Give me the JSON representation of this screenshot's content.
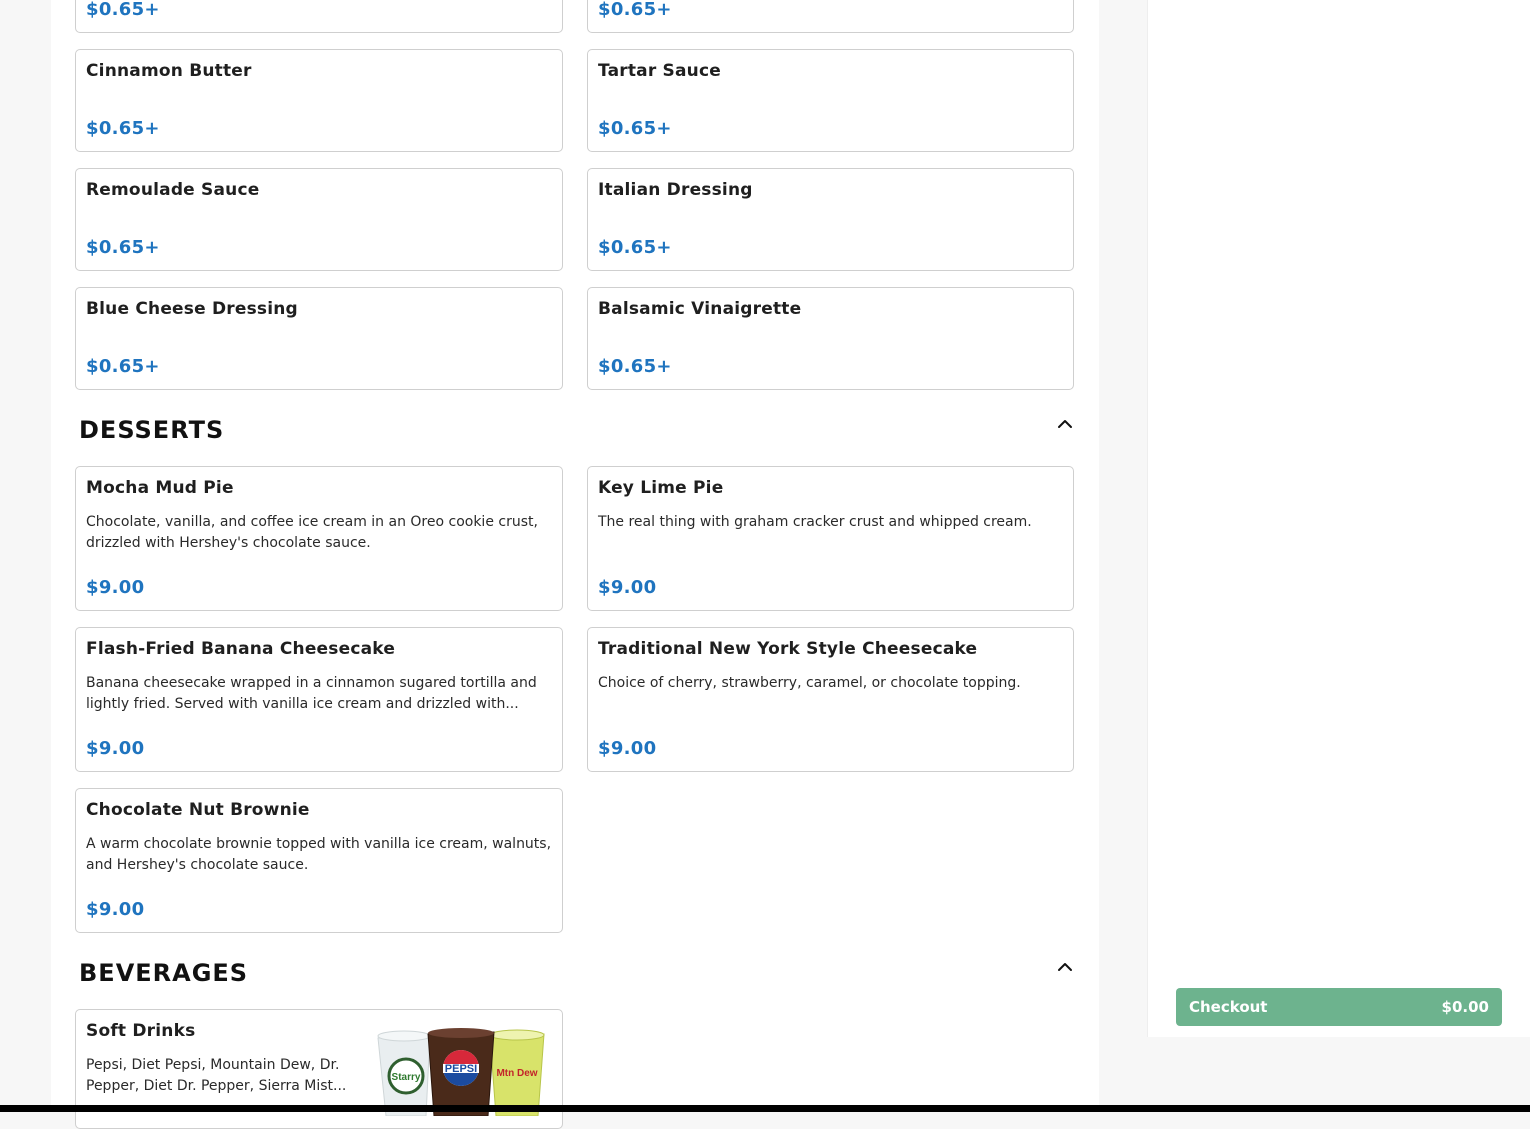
{
  "top_partial": [
    {
      "price": "$0.65+"
    },
    {
      "price": "$0.65+"
    }
  ],
  "sauces": [
    {
      "name": "Cinnamon Butter",
      "price": "$0.65+"
    },
    {
      "name": "Tartar Sauce",
      "price": "$0.65+"
    },
    {
      "name": "Remoulade Sauce",
      "price": "$0.65+"
    },
    {
      "name": "Italian Dressing",
      "price": "$0.65+"
    },
    {
      "name": "Blue Cheese Dressing",
      "price": "$0.65+"
    },
    {
      "name": "Balsamic Vinaigrette",
      "price": "$0.65+"
    }
  ],
  "desserts": {
    "title": "DESSERTS",
    "items": [
      {
        "name": "Mocha Mud Pie",
        "desc": "Chocolate, vanilla, and coffee ice cream in an Oreo cookie crust, drizzled with Hershey's chocolate sauce.",
        "price": "$9.00"
      },
      {
        "name": "Key Lime Pie",
        "desc": "The real thing with graham cracker crust and whipped cream.",
        "price": "$9.00"
      },
      {
        "name": "Flash-Fried Banana Cheesecake",
        "desc": "Banana cheesecake wrapped in a cinnamon sugared tortilla and lightly fried. Served with vanilla ice cream and drizzled with...",
        "price": "$9.00"
      },
      {
        "name": "Traditional New York Style Cheesecake",
        "desc": "Choice of cherry, strawberry, caramel, or chocolate topping.",
        "price": "$9.00"
      },
      {
        "name": "Chocolate Nut Brownie",
        "desc": "A warm chocolate brownie topped with vanilla ice cream, walnuts, and Hershey's chocolate sauce.",
        "price": "$9.00"
      }
    ]
  },
  "beverages": {
    "title": "BEVERAGES",
    "items": [
      {
        "name": "Soft Drinks",
        "desc": "Pepsi, Diet Pepsi, Mountain Dew, Dr. Pepper, Diet Dr. Pepper, Sierra Mist...",
        "cup_labels": [
          "Starry",
          "PEPSI",
          "Mtn Dew"
        ]
      }
    ]
  },
  "checkout": {
    "label": "Checkout",
    "total": "$0.00"
  },
  "colors": {
    "price": "#1f74bf",
    "checkout": "#6db38e"
  }
}
